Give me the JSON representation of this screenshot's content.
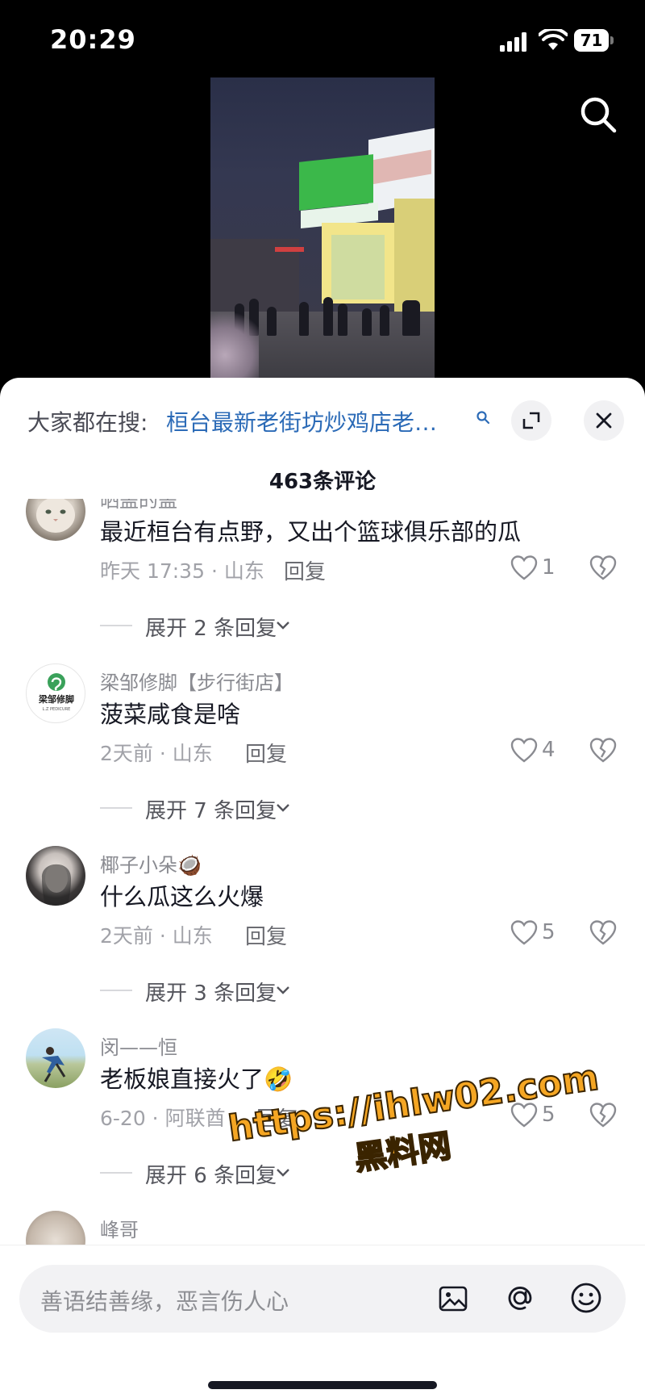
{
  "status_bar": {
    "time": "20:29",
    "battery": "71"
  },
  "search_bar": {
    "prefix": "大家都在搜:",
    "query": "桓台最新老街坊炒鸡店老…"
  },
  "comment_count": "463条评论",
  "comments": [
    {
      "username": "晒盖的盖",
      "text": "最近桓台有点野，又出个篮球俱乐部的瓜",
      "meta": "昨天 17:35 · 山东",
      "reply_label": "回复",
      "likes": "1",
      "expand_label": "展开 2 条回复"
    },
    {
      "username": "梁邹修脚【步行街店】",
      "text": "菠菜咸食是啥",
      "meta": "2天前 · 山东",
      "reply_label": "回复",
      "likes": "4",
      "expand_label": "展开 7 条回复",
      "avatar_logo_text": "梁邹修脚",
      "avatar_logo_sub": "L.Z PEDICURE"
    },
    {
      "username": "椰子小朵🥥",
      "text": "什么瓜这么火爆",
      "meta": "2天前 · 山东",
      "reply_label": "回复",
      "likes": "5",
      "expand_label": "展开 3 条回复"
    },
    {
      "username": "闵——恒",
      "text": "老板娘直接火了🤣",
      "meta": "6-20 · 阿联酋",
      "reply_label": "回复",
      "likes": "5",
      "expand_label": "展开 6 条回复"
    },
    {
      "username": "峰哥"
    }
  ],
  "watermark": {
    "url": "https://ihlw02.com",
    "name": "黑料网"
  },
  "input": {
    "placeholder": "善语结善缘，恶言伤人心"
  },
  "colors": {
    "link": "#2c6bb7",
    "watermark": "#f5a623"
  }
}
